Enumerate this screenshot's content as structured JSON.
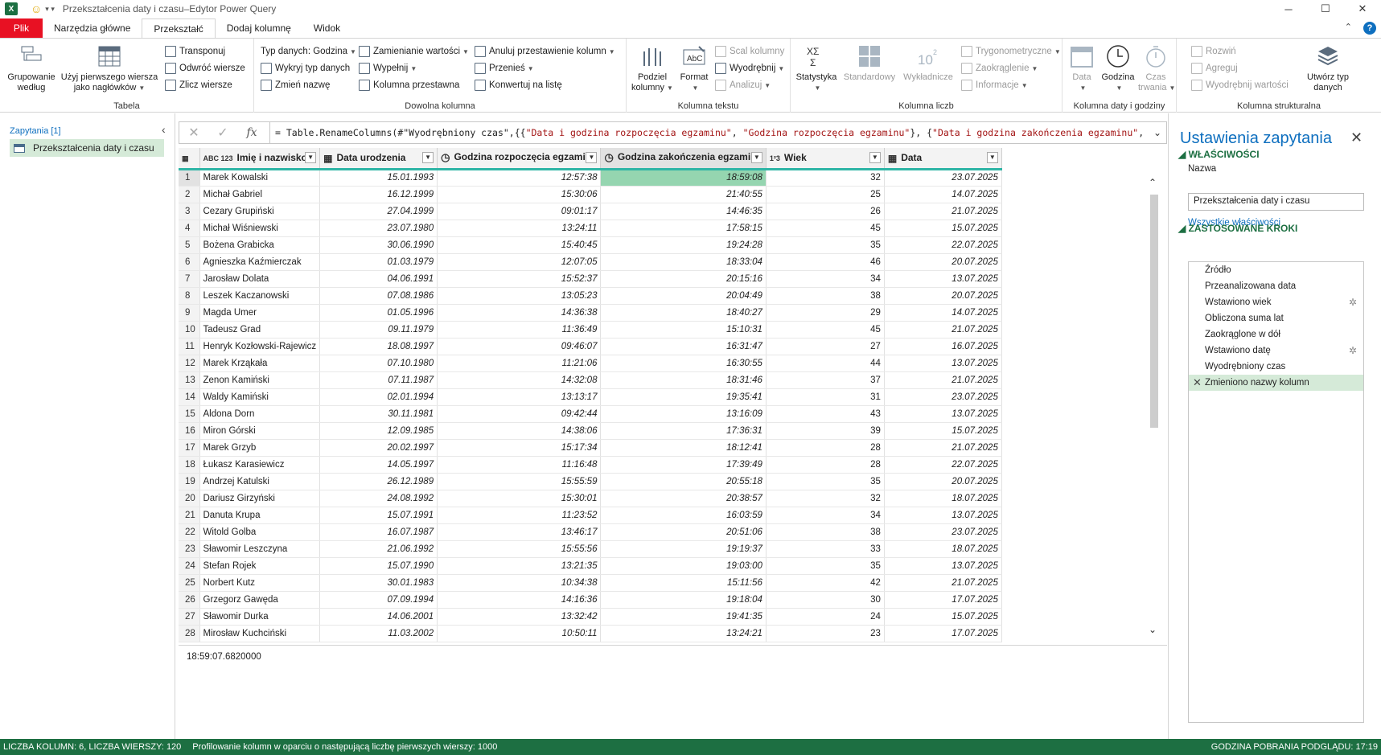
{
  "window": {
    "title": "Przekształcenia daty i czasu–Edytor Power Query",
    "app_icon": "X"
  },
  "tabs": [
    {
      "label": "Plik"
    },
    {
      "label": "Narzędzia główne"
    },
    {
      "label": "Przekształć"
    },
    {
      "label": "Dodaj kolumnę"
    },
    {
      "label": "Widok"
    }
  ],
  "active_tab": "Przekształć",
  "ribbon": {
    "tabela": {
      "group_label": "Tabela",
      "group_by": "Grupowanie według",
      "first_row_l1": "Użyj pierwszego wiersza",
      "first_row_l2": "jako nagłówków",
      "transpose": "Transponuj",
      "reverse_rows": "Odwróć wiersze",
      "count_rows": "Zlicz wiersze"
    },
    "dowolna": {
      "group_label": "Dowolna kolumna",
      "data_type": "Typ danych: Godzina",
      "detect_type": "Wykryj typ danych",
      "rename": "Zmień nazwę",
      "replace_values": "Zamienianie wartości",
      "fill": "Wypełnij",
      "pivot": "Kolumna przestawna",
      "unpivot": "Anuluj przestawienie kolumn",
      "move": "Przenieś",
      "to_list": "Konwertuj na listę"
    },
    "tekst": {
      "group_label": "Kolumna tekstu",
      "split_l1": "Podziel",
      "split_l2": "kolumny",
      "format": "Format",
      "merge": "Scal kolumny",
      "extract": "Wyodrębnij",
      "parse": "Analizuj"
    },
    "liczb": {
      "group_label": "Kolumna liczb",
      "statistics": "Statystyka",
      "standard": "Standardowy",
      "scientific": "Wykładnicze",
      "trig": "Trygonometryczne",
      "rounding": "Zaokrąglenie",
      "information": "Informacje"
    },
    "data": {
      "group_label": "Kolumna daty i godziny",
      "date": "Data",
      "time": "Godzina",
      "duration_l1": "Czas",
      "duration_l2": "trwania"
    },
    "strukt": {
      "group_label": "Kolumna strukturalna",
      "expand": "Rozwiń",
      "aggregate": "Agreguj",
      "extract_values": "Wyodrębnij wartości",
      "create_type_l1": "Utwórz typ",
      "create_type_l2": "danych"
    }
  },
  "queries": {
    "header": "Zapytania [1]",
    "items": [
      "Przekształcenia daty i czasu"
    ]
  },
  "formula": {
    "prefix": "= Table.RenameColumns(#\"Wyodrębniony czas\",{{",
    "s1": "\"Data i godzina rozpoczęcia egzaminu\"",
    "c1": ", ",
    "s2": "\"Godzina rozpoczęcia egzaminu\"",
    "c2": "}, {",
    "s3": "\"Data i godzina zakończenia egzaminu\"",
    "c3": ","
  },
  "columns": [
    {
      "type": "ABC 123",
      "name": "Imię i nazwisko"
    },
    {
      "type": "cal",
      "name": "Data urodzenia"
    },
    {
      "type": "clock",
      "name": "Godzina rozpoczęcia egzaminu"
    },
    {
      "type": "clock",
      "name": "Godzina zakończenia egzaminu"
    },
    {
      "type": "1²3",
      "name": "Wiek"
    },
    {
      "type": "cal",
      "name": "Data"
    }
  ],
  "rows": [
    [
      "1",
      "Marek Kowalski",
      "15.01.1993",
      "12:57:38",
      "18:59:08",
      "32",
      "23.07.2025"
    ],
    [
      "2",
      "Michał Gabriel",
      "16.12.1999",
      "15:30:06",
      "21:40:55",
      "25",
      "14.07.2025"
    ],
    [
      "3",
      "Cezary Grupiński",
      "27.04.1999",
      "09:01:17",
      "14:46:35",
      "26",
      "21.07.2025"
    ],
    [
      "4",
      "Michał Wiśniewski",
      "23.07.1980",
      "13:24:11",
      "17:58:15",
      "45",
      "15.07.2025"
    ],
    [
      "5",
      "Bożena Grabicka",
      "30.06.1990",
      "15:40:45",
      "19:24:28",
      "35",
      "22.07.2025"
    ],
    [
      "6",
      "Agnieszka Kaźmierczak",
      "01.03.1979",
      "12:07:05",
      "18:33:04",
      "46",
      "20.07.2025"
    ],
    [
      "7",
      "Jarosław Dolata",
      "04.06.1991",
      "15:52:37",
      "20:15:16",
      "34",
      "13.07.2025"
    ],
    [
      "8",
      "Leszek Kaczanowski",
      "07.08.1986",
      "13:05:23",
      "20:04:49",
      "38",
      "20.07.2025"
    ],
    [
      "9",
      "Magda Umer",
      "01.05.1996",
      "14:36:38",
      "18:40:27",
      "29",
      "14.07.2025"
    ],
    [
      "10",
      "Tadeusz Grad",
      "09.11.1979",
      "11:36:49",
      "15:10:31",
      "45",
      "21.07.2025"
    ],
    [
      "11",
      "Henryk Kozłowski-Rajewicz",
      "18.08.1997",
      "09:46:07",
      "16:31:47",
      "27",
      "16.07.2025"
    ],
    [
      "12",
      "Marek Krząkała",
      "07.10.1980",
      "11:21:06",
      "16:30:55",
      "44",
      "13.07.2025"
    ],
    [
      "13",
      "Zenon Kamiński",
      "07.11.1987",
      "14:32:08",
      "18:31:46",
      "37",
      "21.07.2025"
    ],
    [
      "14",
      "Waldy Kamiński",
      "02.01.1994",
      "13:13:17",
      "19:35:41",
      "31",
      "23.07.2025"
    ],
    [
      "15",
      "Aldona Dorn",
      "30.11.1981",
      "09:42:44",
      "13:16:09",
      "43",
      "13.07.2025"
    ],
    [
      "16",
      "Miron Górski",
      "12.09.1985",
      "14:38:06",
      "17:36:31",
      "39",
      "15.07.2025"
    ],
    [
      "17",
      "Marek Grzyb",
      "20.02.1997",
      "15:17:34",
      "18:12:41",
      "28",
      "21.07.2025"
    ],
    [
      "18",
      "Łukasz Karasiewicz",
      "14.05.1997",
      "11:16:48",
      "17:39:49",
      "28",
      "22.07.2025"
    ],
    [
      "19",
      "Andrzej Katulski",
      "26.12.1989",
      "15:55:59",
      "20:55:18",
      "35",
      "20.07.2025"
    ],
    [
      "20",
      "Dariusz Girzyński",
      "24.08.1992",
      "15:30:01",
      "20:38:57",
      "32",
      "18.07.2025"
    ],
    [
      "21",
      "Danuta Krupa",
      "15.07.1991",
      "11:23:52",
      "16:03:59",
      "34",
      "13.07.2025"
    ],
    [
      "22",
      "Witold Golba",
      "16.07.1987",
      "13:46:17",
      "20:51:06",
      "38",
      "23.07.2025"
    ],
    [
      "23",
      "Sławomir Leszczyna",
      "21.06.1992",
      "15:55:56",
      "19:19:37",
      "33",
      "18.07.2025"
    ],
    [
      "24",
      "Stefan Rojek",
      "15.07.1990",
      "13:21:35",
      "19:03:00",
      "35",
      "13.07.2025"
    ],
    [
      "25",
      "Norbert Kutz",
      "30.01.1983",
      "10:34:38",
      "15:11:56",
      "42",
      "21.07.2025"
    ],
    [
      "26",
      "Grzegorz Gawęda",
      "07.09.1994",
      "14:16:36",
      "19:18:04",
      "30",
      "17.07.2025"
    ],
    [
      "27",
      "Sławomir Durka",
      "14.06.2001",
      "13:32:42",
      "19:41:35",
      "24",
      "15.07.2025"
    ],
    [
      "28",
      "Mirosław Kuchciński",
      "11.03.2002",
      "10:50:11",
      "13:24:21",
      "23",
      "17.07.2025"
    ]
  ],
  "preview_value": "18:59:07.6820000",
  "settings": {
    "title": "Ustawienia zapytania",
    "properties_header": "WŁAŚCIWOŚCI",
    "name_label": "Nazwa",
    "name_value": "Przekształcenia daty i czasu",
    "all_props_link": "Wszystkie właściwości",
    "steps_header": "ZASTOSOWANE KROKI",
    "steps": [
      {
        "label": "Źródło",
        "gear": false
      },
      {
        "label": "Przeanalizowana data",
        "gear": false
      },
      {
        "label": "Wstawiono wiek",
        "gear": true
      },
      {
        "label": "Obliczona suma lat",
        "gear": false
      },
      {
        "label": "Zaokrąglone w dół",
        "gear": false
      },
      {
        "label": "Wstawiono datę",
        "gear": true
      },
      {
        "label": "Wyodrębniony czas",
        "gear": false
      },
      {
        "label": "Zmieniono nazwy kolumn",
        "gear": false
      }
    ]
  },
  "status": {
    "columns_rows": "LICZBA KOLUMN: 6, LICZBA WIERSZY: 120",
    "profiling": "Profilowanie kolumn w oparciu o następującą liczbę pierwszych wierszy: 1000",
    "preview_time": "GODZINA POBRANIA PODGLĄDU: 17:19"
  },
  "colors": {
    "accent_green": "#1d6f42",
    "file_tab": "#e81123",
    "link_blue": "#0e6fbf",
    "cell_highlight": "#95d5b0"
  }
}
